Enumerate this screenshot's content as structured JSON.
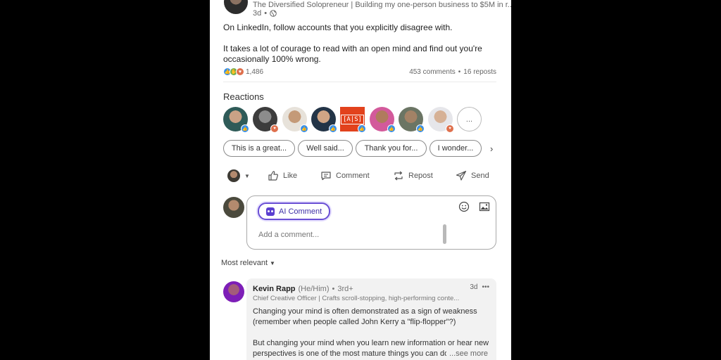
{
  "post": {
    "author_headline": "The Diversified Solopreneur | Building my one-person business to $5M in r...",
    "time": "3d",
    "meta_separator": "•",
    "text_line1": "On LinkedIn, follow accounts that you explicitly disagree with.",
    "text_line2": "It takes a lot of courage to read with an open mind and find out you're",
    "text_line3": "occasionally 100% wrong.",
    "reactions_count": "1,486",
    "comments": "453 comments",
    "counts_separator": "•",
    "reposts": "16 reposts"
  },
  "reactions": {
    "title": "Reactions",
    "company_logo_text": "[A|S]",
    "more_label": "..."
  },
  "suggestions": [
    "This is a great...",
    "Well said...",
    "Thank you for...",
    "I wonder..."
  ],
  "suggestion_next": "›",
  "actions": {
    "like": "Like",
    "comment": "Comment",
    "repost": "Repost",
    "send": "Send"
  },
  "comment_box": {
    "ai_label": "AI Comment",
    "placeholder": "Add a comment..."
  },
  "sort": {
    "label": "Most relevant"
  },
  "comment": {
    "name": "Kevin Rapp",
    "pronouns": "(He/Him)",
    "separator": "•",
    "degree": "3rd+",
    "time": "3d",
    "more": "•••",
    "headline": "Chief Creative Officer | Crafts scroll-stopping, high-performing conte...",
    "line1": "Changing your mind is often demonstrated as a sign of weakness",
    "line2": "(remember when people called John Kerry a \"flip-flopper\"?)",
    "line3": "But changing your mind when you learn new information or hear new",
    "line4": "perspectives is one of the most mature things you can do",
    "see_more": "...see more"
  },
  "colors": {
    "background": "#000000",
    "panel": "#ffffff",
    "ai_accent": "#6a4fd4",
    "like_blue": "#378fe9",
    "love_orange": "#df704d"
  }
}
